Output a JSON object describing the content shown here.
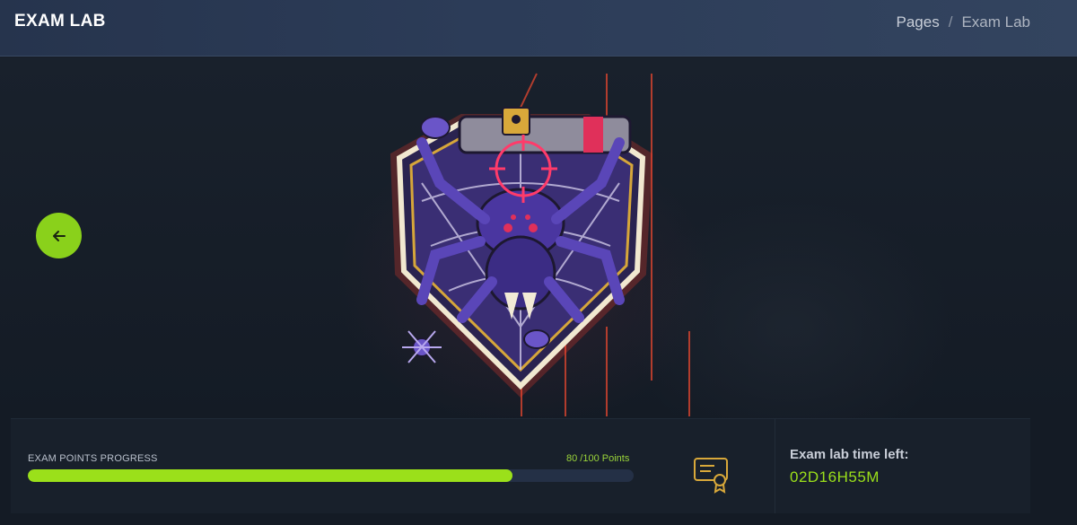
{
  "header": {
    "title": "EXAM LAB",
    "breadcrumb": {
      "link": "Pages",
      "separator": "/",
      "current": "Exam Lab"
    }
  },
  "stage": {
    "back_button_icon": "arrow-left-icon",
    "emblem_icon": "spider-emblem-icon"
  },
  "progress": {
    "label": "EXAM POINTS PROGRESS",
    "points_text": "80 /100 Points",
    "value": 80,
    "max": 100
  },
  "certificate_icon": "certificate-icon",
  "timer": {
    "label": "Exam lab time left:",
    "value": "02D16H55M"
  },
  "colors": {
    "accent": "#9be01a",
    "header_bg": "#2c3c58",
    "page_bg": "#161d28",
    "progress_track": "#243046",
    "emblem_purple": "#5a3fa8",
    "emblem_red": "#e0305a"
  }
}
